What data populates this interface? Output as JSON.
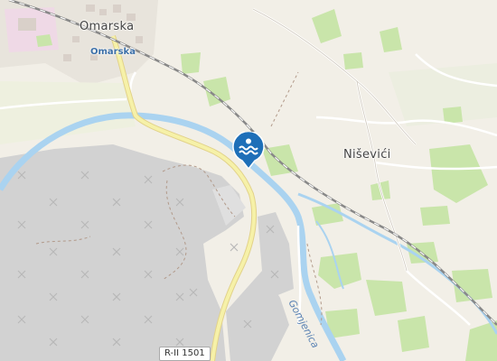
{
  "map": {
    "labels": {
      "town_omarska": "Omarska",
      "station_omarska": "Omarska",
      "village_nisevici": "Niševići",
      "road_ref": "R-II 1501",
      "river_name": "Gomjenica"
    },
    "marker": {
      "icon": "swimming-water-icon",
      "color": "#1e6fb8"
    },
    "colors": {
      "background": "#f2efe7",
      "quarry": "#d3d3d3",
      "forest": "#c6e3a6",
      "water": "#aad3f0",
      "road_major": "#f6f1a8",
      "railway": "#808080"
    }
  }
}
